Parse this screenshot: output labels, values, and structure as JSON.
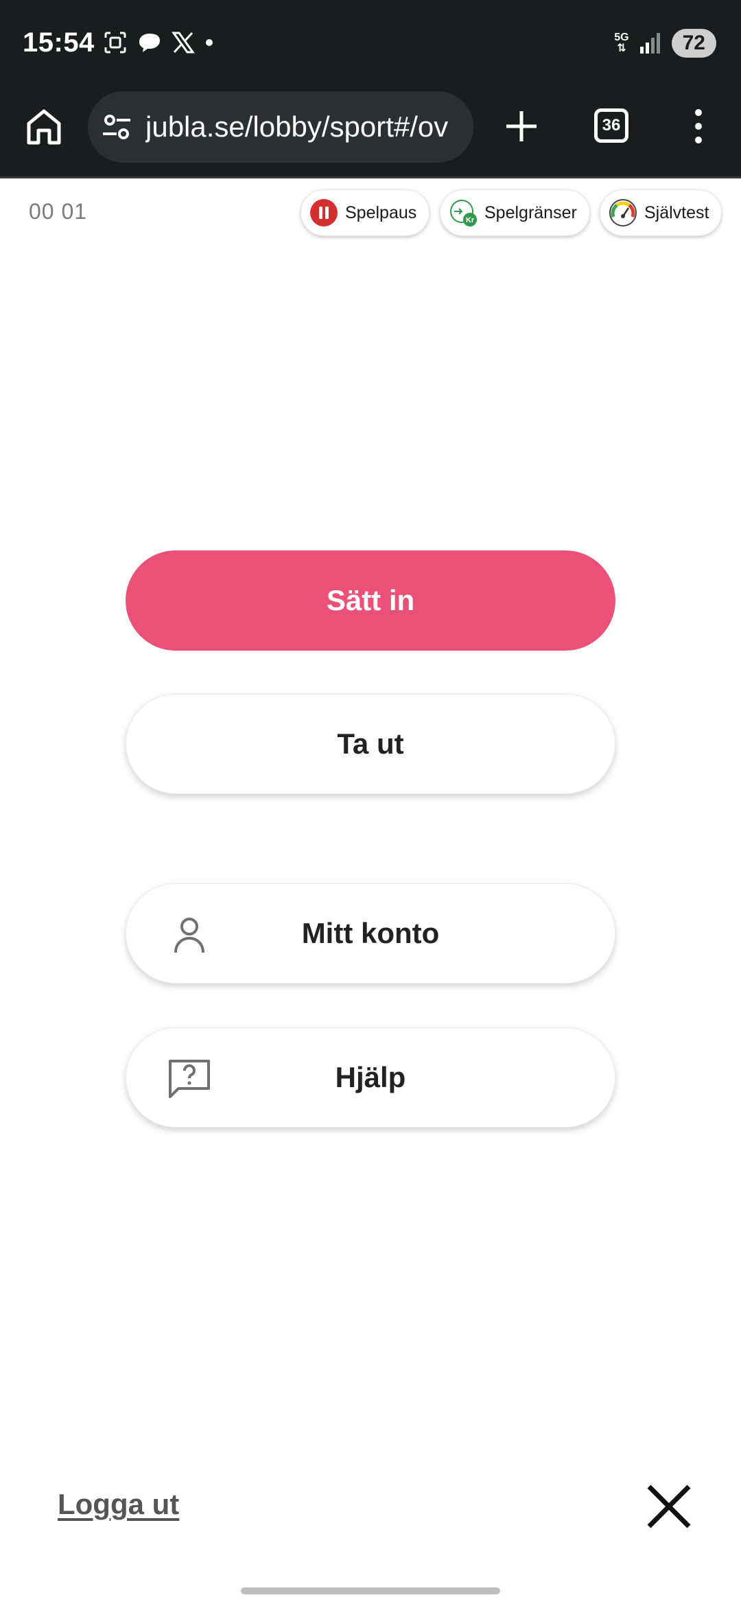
{
  "status_bar": {
    "time": "15:54",
    "network": "5G",
    "battery": "72",
    "icons": [
      "screenshot-icon",
      "chat-bubble-icon",
      "x-logo-icon",
      "dot-icon",
      "signal-icon"
    ]
  },
  "browser": {
    "url": "jubla.se/lobby/sport#/ov",
    "tab_count": "36"
  },
  "page": {
    "timer": "00 01",
    "chips": [
      {
        "label": "Spelpaus",
        "icon": "pause-icon",
        "color": "#d3302f"
      },
      {
        "label": "Spelgränser",
        "icon": "limit-icon",
        "color": "#2e9a4a"
      },
      {
        "label": "Självtest",
        "icon": "gauge-icon",
        "color": "#f2a312"
      }
    ],
    "buttons": {
      "deposit": "Sätt in",
      "withdraw": "Ta ut",
      "account": "Mitt konto",
      "help": "Hjälp"
    },
    "logout": "Logga ut",
    "accent_color": "#eb5177"
  }
}
